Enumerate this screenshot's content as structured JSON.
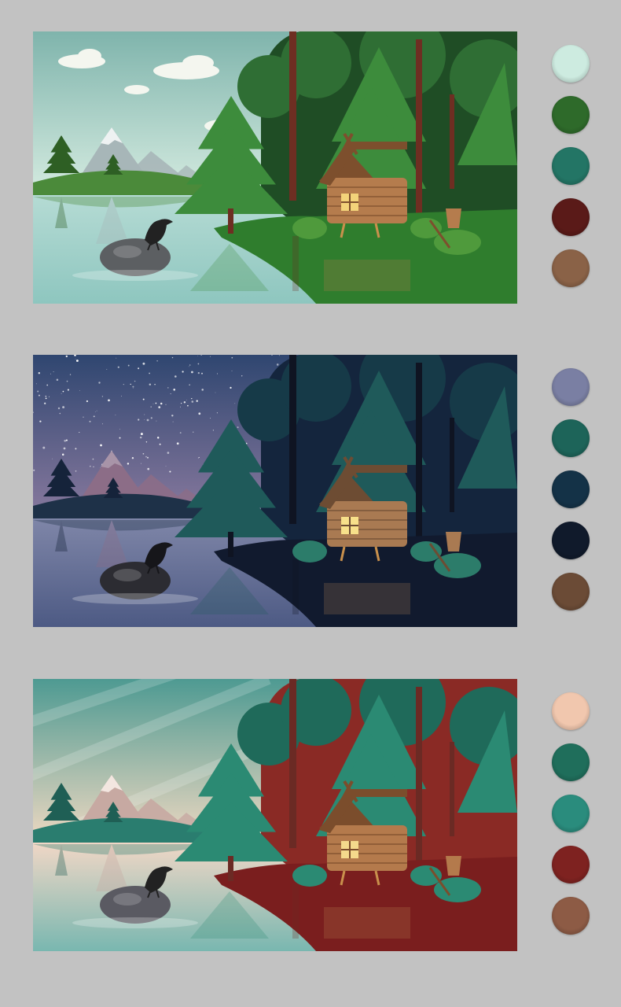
{
  "scenes": [
    {
      "id": "day",
      "sky_top": "#7fb4ac",
      "sky_bottom": "#d6ece1",
      "mountain": "#a7b6b8",
      "snow": "#eef2f2",
      "hill": "#4b8a3a",
      "hill_dark": "#2e5f24",
      "water_top": "#b5dbd4",
      "water_bottom": "#8ec6bf",
      "forest_back": "#1f4d25",
      "forest_mid": "#2f6e34",
      "forest_front": "#3d8c3c",
      "ground": "#2f7d2d",
      "trunk": "#6e2e22",
      "cabin": "#b57c4d",
      "cabin_dark": "#7d4f2d",
      "window": "#f3d37a",
      "bush": "#4f9a3c",
      "rock": "#5c5f62",
      "crow": "#222222",
      "swatches": [
        "#cdebe0",
        "#2e6a2a",
        "#237565",
        "#5a1a18",
        "#8a6247"
      ]
    },
    {
      "id": "night",
      "sky_top": "#2f4670",
      "sky_bottom": "#8a7a9f",
      "mountain": "#8c6d87",
      "snow": "#a894a8",
      "hill": "#1e3148",
      "hill_dark": "#15233a",
      "water_top": "#7f86a8",
      "water_bottom": "#4d5a84",
      "forest_back": "#14253d",
      "forest_mid": "#163a48",
      "forest_front": "#1f5a5a",
      "ground": "#111a2e",
      "trunk": "#0f1422",
      "cabin": "#a97a52",
      "cabin_dark": "#6d4c33",
      "window": "#f7e08a",
      "bush": "#2c7c6a",
      "rock": "#2c2c32",
      "crow": "#16161a",
      "swatches": [
        "#7a7fa3",
        "#1d6459",
        "#143247",
        "#101a2b",
        "#6b4b36"
      ]
    },
    {
      "id": "dusk",
      "sky_top": "#4e9a92",
      "sky_bottom": "#f0d9c2",
      "mountain": "#c7a9a2",
      "snow": "#f3e6e0",
      "hill": "#2a7d6f",
      "hill_dark": "#1f5f55",
      "water_top": "#f1d7c6",
      "water_bottom": "#79b7b0",
      "forest_back": "#8a2a25",
      "forest_mid": "#1f6a5a",
      "forest_front": "#2b8a73",
      "ground": "#7a1e1e",
      "trunk": "#6b2a24",
      "cabin": "#b47a4c",
      "cabin_dark": "#7b4d2c",
      "window": "#f4d98c",
      "bush": "#2b8a73",
      "rock": "#5a5a62",
      "crow": "#222222",
      "swatches": [
        "#f1c7ae",
        "#1f6e5b",
        "#2a8c7d",
        "#7e2220",
        "#8d5b45"
      ]
    }
  ]
}
